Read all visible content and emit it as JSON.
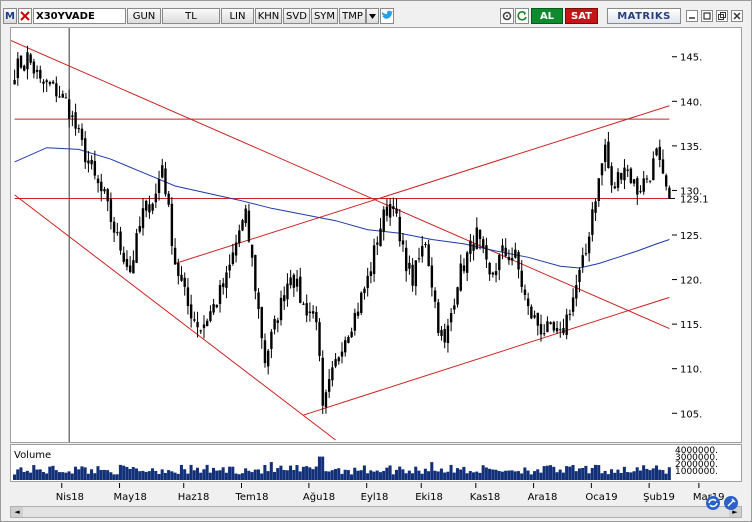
{
  "toolbar": {
    "logo": "M",
    "symbol": "X30YVADE",
    "period": "GUN",
    "currency": "TL",
    "buttons": [
      "LIN",
      "KHN",
      "SVD",
      "SYM",
      "TMP"
    ],
    "buy_label": "AL",
    "sell_label": "SAT",
    "brand": "MATRIKS"
  },
  "colors": {
    "candle": "#000000",
    "moving_average": "#1f3aa8",
    "trend_lines": "#cc2222",
    "volume": "#12307a",
    "buy": "#0f8a2f",
    "sell": "#c31616"
  },
  "chart_data": {
    "type": "candlestick",
    "symbol": "X30YVADE",
    "ylim": [
      102,
      148
    ],
    "y_ticks": [
      "105.",
      "110.",
      "115.",
      "120.",
      "125.",
      "130.",
      "135.",
      "140.",
      "145."
    ],
    "last_price_label": "129.1",
    "x_labels": [
      "Nis18",
      "May18",
      "Haz18",
      "Tem18",
      "Ağu18",
      "Eyl18",
      "Eki18",
      "Kas18",
      "Ara18",
      "Oca19",
      "Şub19",
      "Mar19"
    ],
    "grid": false,
    "close_path": [
      [
        0,
        143.5
      ],
      [
        4,
        145.0
      ],
      [
        8,
        142.0
      ],
      [
        12,
        141.5
      ],
      [
        16,
        140.0
      ],
      [
        20,
        136.0
      ],
      [
        24,
        132.0
      ],
      [
        28,
        129.0
      ],
      [
        32,
        124.5
      ],
      [
        36,
        121.0
      ],
      [
        40,
        127.5
      ],
      [
        44,
        129.5
      ],
      [
        46,
        133.0
      ],
      [
        50,
        122.0
      ],
      [
        54,
        117.0
      ],
      [
        58,
        114.5
      ],
      [
        62,
        117.0
      ],
      [
        66,
        120.0
      ],
      [
        70,
        125.5
      ],
      [
        72,
        127.0
      ],
      [
        74,
        122.0
      ],
      [
        78,
        111.0
      ],
      [
        82,
        116.0
      ],
      [
        86,
        121.0
      ],
      [
        90,
        117.0
      ],
      [
        94,
        116.0
      ],
      [
        96,
        105.0
      ],
      [
        98,
        108.0
      ],
      [
        102,
        113.0
      ],
      [
        106,
        116.0
      ],
      [
        110,
        120.0
      ],
      [
        114,
        126.0
      ],
      [
        116,
        128.0
      ],
      [
        118,
        129.0
      ],
      [
        120,
        124.0
      ],
      [
        124,
        120.0
      ],
      [
        128,
        124.5
      ],
      [
        132,
        115.0
      ],
      [
        134,
        112.5
      ],
      [
        138,
        120.0
      ],
      [
        142,
        123.5
      ],
      [
        144,
        125.0
      ],
      [
        148,
        120.0
      ],
      [
        152,
        123.0
      ],
      [
        156,
        122.5
      ],
      [
        160,
        116.5
      ],
      [
        164,
        114.5
      ],
      [
        168,
        114.0
      ],
      [
        170,
        113.5
      ],
      [
        174,
        118.0
      ],
      [
        178,
        123.0
      ],
      [
        180,
        128.0
      ],
      [
        182,
        131.0
      ],
      [
        184,
        135.0
      ],
      [
        186,
        130.0
      ],
      [
        190,
        133.0
      ],
      [
        194,
        130.0
      ],
      [
        198,
        132.0
      ],
      [
        200,
        134.0
      ],
      [
        202,
        131.0
      ],
      [
        204,
        129.1
      ]
    ],
    "moving_average": [
      [
        0,
        133.2
      ],
      [
        10,
        134.8
      ],
      [
        20,
        134.6
      ],
      [
        30,
        133.5
      ],
      [
        40,
        132.0
      ],
      [
        50,
        130.5
      ],
      [
        60,
        129.7
      ],
      [
        70,
        128.9
      ],
      [
        80,
        128.0
      ],
      [
        90,
        127.3
      ],
      [
        100,
        126.6
      ],
      [
        110,
        125.6
      ],
      [
        120,
        125.2
      ],
      [
        130,
        124.5
      ],
      [
        140,
        124.0
      ],
      [
        150,
        123.2
      ],
      [
        160,
        122.5
      ],
      [
        170,
        121.5
      ],
      [
        176,
        121.3
      ],
      [
        182,
        121.8
      ],
      [
        188,
        122.5
      ],
      [
        194,
        123.2
      ],
      [
        200,
        124.0
      ],
      [
        204,
        124.5
      ]
    ],
    "trend_lines": [
      {
        "from": [
          -15,
          149.0
        ],
        "to": [
          204,
          114.5
        ]
      },
      {
        "from": [
          0,
          129.5
        ],
        "to": [
          100,
          102.0
        ]
      },
      {
        "from": [
          90,
          104.8
        ],
        "to": [
          204,
          118.0
        ]
      },
      {
        "from": [
          50,
          121.8
        ],
        "to": [
          204,
          139.5
        ]
      },
      {
        "from": [
          0,
          138.0
        ],
        "to": [
          204,
          138.0
        ]
      },
      {
        "from": [
          0,
          129.1
        ],
        "to": [
          204,
          129.1
        ]
      }
    ],
    "vertical_marker_index": 17,
    "volume": {
      "label": "Volume",
      "y_ticks": [
        "4000000.",
        "3000000.",
        "2000000.",
        "1000000."
      ],
      "ylim": [
        0,
        4500000
      ]
    }
  },
  "scroll": {
    "left_arrow": "◄",
    "right_arrow": "►"
  }
}
